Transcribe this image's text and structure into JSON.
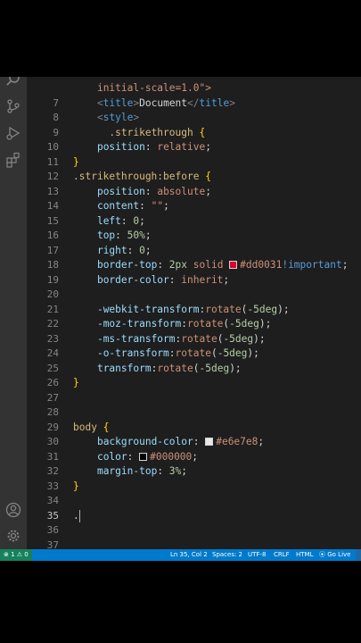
{
  "statusbar": {
    "problems": "⊗ 1 ⚠ 0",
    "cursor": "Ln 35, Col 2",
    "spaces": "Spaces: 2",
    "encoding": "UTF-8",
    "eol": "CRLF",
    "language": "HTML",
    "golive": "Go Live"
  },
  "icons": [
    "search-icon",
    "source-control-icon",
    "run-debug-icon",
    "extensions-icon",
    "account-icon",
    "settings-gear-icon"
  ],
  "colors": {
    "swatch_red": "#dd0031",
    "swatch_gray": "#e6e7e8",
    "swatch_black": "#000000"
  },
  "editor": {
    "active_line": "35",
    "lines": [
      {
        "n": "",
        "tokens": [
          {
            "t": "initial-scale=1.0\">",
            "c": "val",
            "i": "    "
          }
        ]
      },
      {
        "n": "7",
        "tokens": [
          {
            "t": "<",
            "c": "punc",
            "i": "    "
          },
          {
            "t": "title",
            "c": "tag"
          },
          {
            "t": ">",
            "c": "punc"
          },
          {
            "t": "Document",
            "c": "text"
          },
          {
            "t": "</",
            "c": "punc"
          },
          {
            "t": "title",
            "c": "tag"
          },
          {
            "t": ">",
            "c": "punc"
          }
        ]
      },
      {
        "n": "8",
        "tokens": [
          {
            "t": "<",
            "c": "punc",
            "i": "    "
          },
          {
            "t": "style",
            "c": "tag"
          },
          {
            "t": ">",
            "c": "punc"
          }
        ]
      },
      {
        "n": "9",
        "tokens": [
          {
            "t": ".strikethrough ",
            "c": "sel",
            "i": "      "
          },
          {
            "t": "{",
            "c": "brace"
          }
        ]
      },
      {
        "n": "10",
        "tokens": [
          {
            "t": "position",
            "c": "prop",
            "i": "    "
          },
          {
            "t": ": ",
            "c": "text"
          },
          {
            "t": "relative",
            "c": "val"
          },
          {
            "t": ";",
            "c": "text"
          }
        ]
      },
      {
        "n": "11",
        "tokens": [
          {
            "t": "}",
            "c": "brace",
            "i": ""
          }
        ]
      },
      {
        "n": "12",
        "tokens": [
          {
            "t": ".strikethrough:before ",
            "c": "sel",
            "i": ""
          },
          {
            "t": "{",
            "c": "brace"
          }
        ]
      },
      {
        "n": "13",
        "tokens": [
          {
            "t": "position",
            "c": "prop",
            "i": "    "
          },
          {
            "t": ": ",
            "c": "text"
          },
          {
            "t": "absolute",
            "c": "val"
          },
          {
            "t": ";",
            "c": "text"
          }
        ]
      },
      {
        "n": "14",
        "tokens": [
          {
            "t": "content",
            "c": "prop",
            "i": "    "
          },
          {
            "t": ": ",
            "c": "text"
          },
          {
            "t": "\"\"",
            "c": "val"
          },
          {
            "t": ";",
            "c": "text"
          }
        ]
      },
      {
        "n": "15",
        "tokens": [
          {
            "t": "left",
            "c": "prop",
            "i": "    "
          },
          {
            "t": ": ",
            "c": "text"
          },
          {
            "t": "0",
            "c": "num"
          },
          {
            "t": ";",
            "c": "text"
          }
        ]
      },
      {
        "n": "16",
        "tokens": [
          {
            "t": "top",
            "c": "prop",
            "i": "    "
          },
          {
            "t": ": ",
            "c": "text"
          },
          {
            "t": "50%",
            "c": "num"
          },
          {
            "t": ";",
            "c": "text"
          }
        ]
      },
      {
        "n": "17",
        "tokens": [
          {
            "t": "right",
            "c": "prop",
            "i": "    "
          },
          {
            "t": ": ",
            "c": "text"
          },
          {
            "t": "0",
            "c": "num"
          },
          {
            "t": ";",
            "c": "text"
          }
        ]
      },
      {
        "n": "18",
        "tokens": [
          {
            "t": "border-top",
            "c": "prop",
            "i": "    "
          },
          {
            "t": ": ",
            "c": "text"
          },
          {
            "t": "2px",
            "c": "num"
          },
          {
            "t": " solid ",
            "c": "val"
          },
          {
            "sw": "swatch_red"
          },
          {
            "t": "#dd0031",
            "c": "val"
          },
          {
            "t": "!important",
            "c": "imp"
          },
          {
            "t": ";",
            "c": "text"
          }
        ]
      },
      {
        "n": "19",
        "tokens": [
          {
            "t": "border-color",
            "c": "prop",
            "i": "    "
          },
          {
            "t": ": ",
            "c": "text"
          },
          {
            "t": "inherit",
            "c": "val"
          },
          {
            "t": ";",
            "c": "text"
          }
        ]
      },
      {
        "n": "20",
        "tokens": []
      },
      {
        "n": "21",
        "tokens": [
          {
            "t": "-webkit-transform",
            "c": "prop",
            "i": "    "
          },
          {
            "t": ":",
            "c": "text"
          },
          {
            "t": "rotate",
            "c": "val"
          },
          {
            "t": "(",
            "c": "text"
          },
          {
            "t": "-5deg",
            "c": "num"
          },
          {
            "t": ");",
            "c": "text"
          }
        ]
      },
      {
        "n": "22",
        "tokens": [
          {
            "t": "-moz-transform",
            "c": "prop",
            "i": "    "
          },
          {
            "t": ":",
            "c": "text"
          },
          {
            "t": "rotate",
            "c": "val"
          },
          {
            "t": "(",
            "c": "text"
          },
          {
            "t": "-5deg",
            "c": "num"
          },
          {
            "t": ");",
            "c": "text"
          }
        ]
      },
      {
        "n": "23",
        "tokens": [
          {
            "t": "-ms-transform",
            "c": "prop",
            "i": "    "
          },
          {
            "t": ":",
            "c": "text"
          },
          {
            "t": "rotate",
            "c": "val"
          },
          {
            "t": "(",
            "c": "text"
          },
          {
            "t": "-5deg",
            "c": "num"
          },
          {
            "t": ");",
            "c": "text"
          }
        ]
      },
      {
        "n": "24",
        "tokens": [
          {
            "t": "-o-transform",
            "c": "prop",
            "i": "    "
          },
          {
            "t": ":",
            "c": "text"
          },
          {
            "t": "rotate",
            "c": "val"
          },
          {
            "t": "(",
            "c": "text"
          },
          {
            "t": "-5deg",
            "c": "num"
          },
          {
            "t": ");",
            "c": "text"
          }
        ]
      },
      {
        "n": "25",
        "tokens": [
          {
            "t": "transform",
            "c": "prop",
            "i": "    "
          },
          {
            "t": ":",
            "c": "text"
          },
          {
            "t": "rotate",
            "c": "val"
          },
          {
            "t": "(",
            "c": "text"
          },
          {
            "t": "-5deg",
            "c": "num"
          },
          {
            "t": ");",
            "c": "text"
          }
        ]
      },
      {
        "n": "26",
        "tokens": [
          {
            "t": "}",
            "c": "brace",
            "i": ""
          }
        ]
      },
      {
        "n": "27",
        "tokens": []
      },
      {
        "n": "28",
        "tokens": []
      },
      {
        "n": "29",
        "tokens": [
          {
            "t": "body ",
            "c": "sel",
            "i": ""
          },
          {
            "t": "{",
            "c": "brace"
          }
        ]
      },
      {
        "n": "30",
        "tokens": [
          {
            "t": "background-color",
            "c": "prop",
            "i": "    "
          },
          {
            "t": ": ",
            "c": "text"
          },
          {
            "sw": "swatch_gray"
          },
          {
            "t": "#e6e7e8",
            "c": "val"
          },
          {
            "t": ";",
            "c": "text"
          }
        ]
      },
      {
        "n": "31",
        "tokens": [
          {
            "t": "color",
            "c": "prop",
            "i": "    "
          },
          {
            "t": ": ",
            "c": "text"
          },
          {
            "sw": "swatch_black"
          },
          {
            "t": "#000000",
            "c": "val"
          },
          {
            "t": ";",
            "c": "text"
          }
        ]
      },
      {
        "n": "32",
        "tokens": [
          {
            "t": "margin-top",
            "c": "prop",
            "i": "    "
          },
          {
            "t": ": ",
            "c": "text"
          },
          {
            "t": "3%",
            "c": "num"
          },
          {
            "t": ";",
            "c": "text"
          }
        ]
      },
      {
        "n": "33",
        "tokens": [
          {
            "t": "}",
            "c": "brace",
            "i": ""
          }
        ]
      },
      {
        "n": "34",
        "tokens": []
      },
      {
        "n": "35",
        "tokens": [
          {
            "t": ".",
            "c": "text",
            "i": ""
          }
        ]
      },
      {
        "n": "36",
        "tokens": []
      },
      {
        "n": "37",
        "tokens": []
      }
    ]
  }
}
